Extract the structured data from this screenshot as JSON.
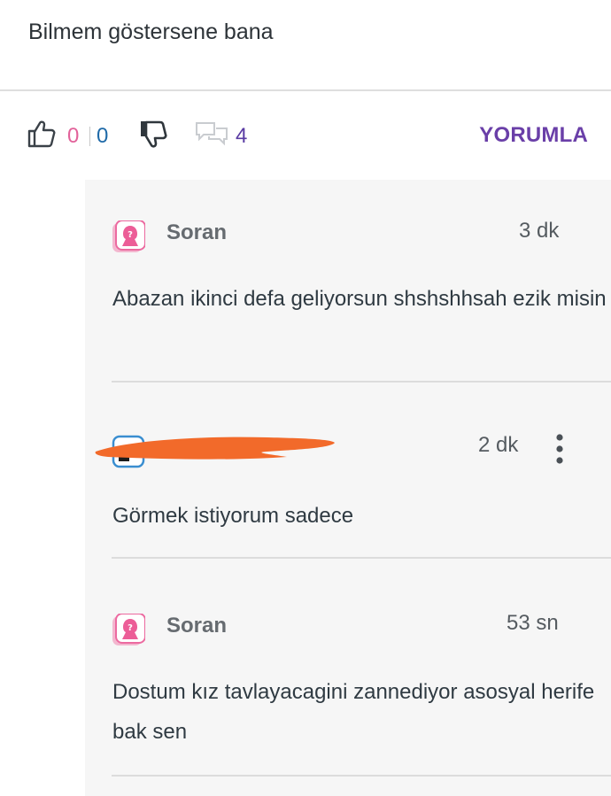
{
  "post": {
    "text": "Bilmem göstersene bana"
  },
  "actions": {
    "like_count": "0",
    "dislike_count": "0",
    "comment_count": "4",
    "comment_button": "YORUMLA"
  },
  "comments": [
    {
      "author": "Soran",
      "time": "3 dk",
      "text": "Abazan ikinci defa geliyorsun shshshhsah ezik misin",
      "avatar": "pink-question-avatar"
    },
    {
      "author": "",
      "time": "2 dk",
      "text": "Görmek istiyorum sadece",
      "avatar": "blue-avatar",
      "redacted": true
    },
    {
      "author": "Soran",
      "time": "53 sn",
      "text": "Dostum kız tavlayacagini zannediyor asosyal herife bak sen",
      "avatar": "pink-question-avatar"
    }
  ],
  "colors": {
    "like": "#e2629a",
    "dislike": "#1f6aa8",
    "accent": "#6a3fa8",
    "redaction": "#f26a2a"
  }
}
